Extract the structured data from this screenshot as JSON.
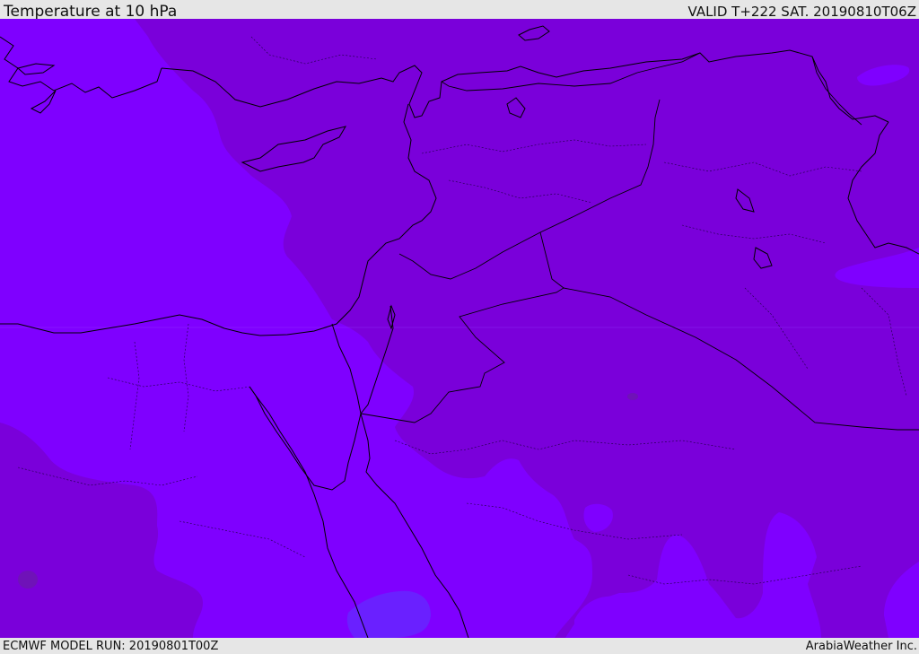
{
  "header": {
    "title": "Temperature at 10 hPa",
    "valid": "VALID T+222 SAT. 20190810T06Z"
  },
  "footer": {
    "model_run": "ECMWF MODEL RUN: 20190801T00Z",
    "credit": "ArabiaWeather Inc."
  },
  "map": {
    "variable": "temperature",
    "pressure_level": "10 hPa",
    "colors": {
      "warm_band": "#7a00da",
      "cool_band": "#7f00ff",
      "coolest_patch": "#6a20ff",
      "warmest_spot": "#6f12b8",
      "coastline": "#000000",
      "border": "#2a0050"
    }
  }
}
